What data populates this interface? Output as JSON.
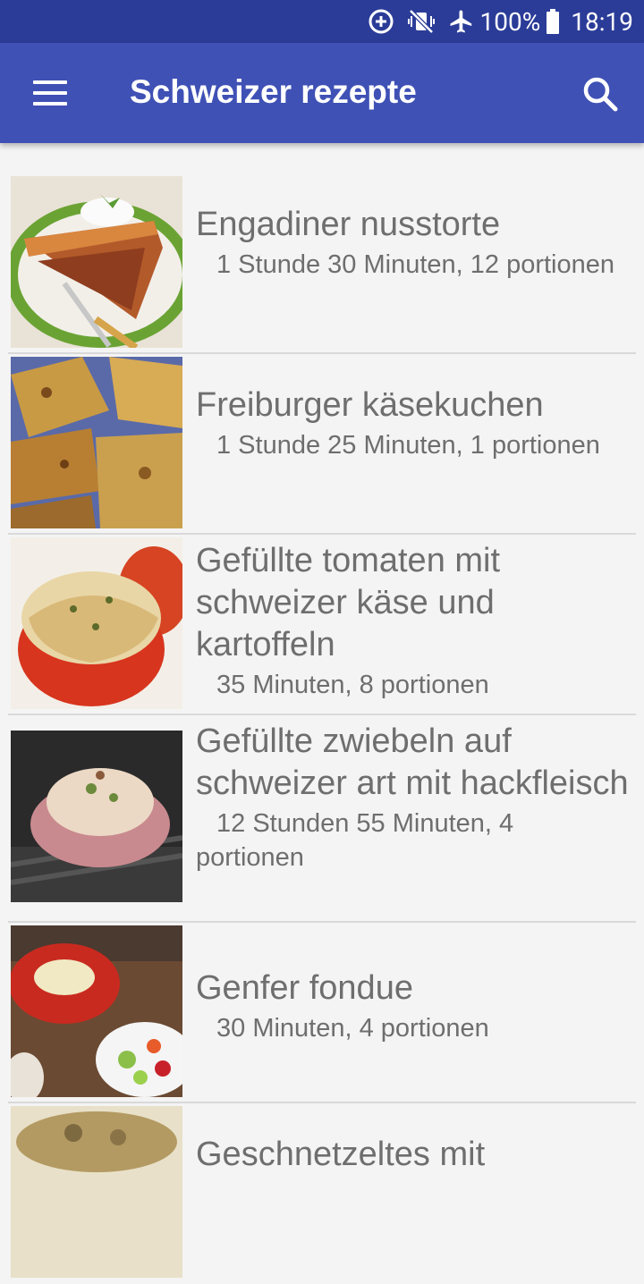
{
  "status_bar": {
    "battery_percent": "100%",
    "time": "18:19",
    "icons": [
      "data-saver-icon",
      "vibrate-icon",
      "airplane-mode-icon",
      "battery-icon"
    ]
  },
  "app_bar": {
    "title": "Schweizer rezepte",
    "menu_icon": "hamburger-menu-icon",
    "search_icon": "search-icon",
    "color": "#3f51b5",
    "status_color": "#2b3c98"
  },
  "recipes": [
    {
      "title": "Engadiner nusstorte",
      "meta": "1 Stunde 30 Minuten, 12 portionen"
    },
    {
      "title": "Freiburger käsekuchen",
      "meta": "1 Stunde 25 Minuten, 1 portionen"
    },
    {
      "title": "Gefüllte tomaten mit schweizer käse und kartoffeln",
      "meta": "35 Minuten, 8 portionen"
    },
    {
      "title": "Gefüllte zwiebeln auf schweizer art mit hackfleisch",
      "meta": "12 Stunden 55 Minuten, 4 portionen"
    },
    {
      "title": "Genfer fondue",
      "meta": "30 Minuten, 4 portionen"
    },
    {
      "title": "Geschnetzeltes mit",
      "meta": ""
    }
  ]
}
